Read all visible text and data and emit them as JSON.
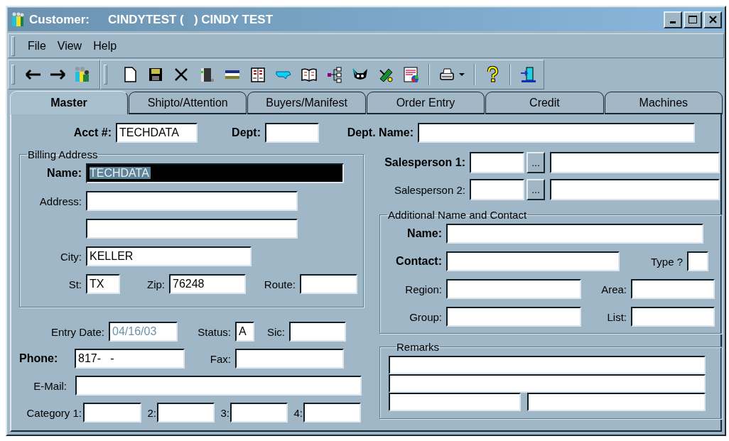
{
  "window": {
    "title": "Customer:",
    "record": "CINDYTEST (   ) CINDY TEST"
  },
  "menu": [
    {
      "label": "File"
    },
    {
      "label": "View"
    },
    {
      "label": "Help"
    }
  ],
  "tabs": [
    {
      "label": "Master",
      "selected": true
    },
    {
      "label": "Shipto/Attention",
      "selected": false
    },
    {
      "label": "Buyers/Manifest",
      "selected": false
    },
    {
      "label": "Order Entry",
      "selected": false
    },
    {
      "label": "Credit",
      "selected": false
    },
    {
      "label": "Machines",
      "selected": false
    }
  ],
  "header": [
    {
      "label": "Acct #:",
      "value": "TECHDATA",
      "bold": true,
      "selected": false
    },
    {
      "label": "Dept:",
      "bold": true,
      "selected": false
    },
    {
      "label": "Dept. Name:",
      "bold": true,
      "selected": false
    }
  ],
  "billing_address": {
    "title": "Billing Address",
    "rows": [
      {
        "fields": [
          {
            "label": "Name:",
            "value": "TECHDATA",
            "bold": true,
            "selected": true
          }
        ]
      },
      {
        "fields": [
          {
            "label": "Address:",
            "bold": false,
            "selected": false
          }
        ]
      },
      {
        "fields": [
          {
            "selected": false
          }
        ]
      },
      {
        "fields": [
          {
            "label": "City:",
            "value": "KELLER",
            "bold": false,
            "selected": false
          }
        ]
      },
      {
        "fields": [
          {
            "label": "St:",
            "value": "TX",
            "bold": false,
            "selected": false
          },
          {
            "label": "Zip:",
            "value": "76248",
            "bold": false,
            "selected": false
          },
          {
            "label": "Route:",
            "bold": false,
            "selected": false
          }
        ]
      }
    ]
  },
  "contact": {
    "rows": [
      {
        "fields": [
          {
            "label": "Entry Date:",
            "value": "04/16/03",
            "bold": false,
            "selected": false,
            "disabled": true
          },
          {
            "label": "Status:",
            "value": "A",
            "bold": false,
            "selected": false
          },
          {
            "label": "Sic:",
            "bold": false,
            "selected": false
          }
        ]
      },
      {
        "fields": [
          {
            "label": "Phone:",
            "value": "817-   -",
            "bold": true,
            "selected": false
          },
          {
            "label": "Fax:",
            "bold": false,
            "selected": false
          }
        ]
      },
      {
        "fields": [
          {
            "label": "E-Mail:",
            "bold": false,
            "selected": false
          }
        ]
      },
      {
        "fields": [
          {
            "label": "Category 1:",
            "bold": false,
            "selected": false
          },
          {
            "label": "2:",
            "bold": false,
            "selected": false
          },
          {
            "label": "3:",
            "bold": false,
            "selected": false
          },
          {
            "label": "4:",
            "bold": false,
            "selected": false
          }
        ]
      }
    ]
  },
  "salespersons": [
    {
      "label": "Salesperson 1:",
      "bold": true,
      "browse": "..."
    },
    {
      "label": "Salesperson 2:",
      "bold": false,
      "browse": "..."
    }
  ],
  "additional_contact": {
    "title": "Additional Name and Contact",
    "rows": [
      {
        "fields": [
          {
            "label": "Name:",
            "bold": true,
            "selected": false
          }
        ]
      },
      {
        "fields": [
          {
            "label": "Contact:",
            "bold": true,
            "selected": false
          },
          {
            "label": "Type ?",
            "bold": false,
            "selected": false
          }
        ]
      },
      {
        "fields": [
          {
            "label": "Region:",
            "bold": false,
            "selected": false
          },
          {
            "label": "Area:",
            "bold": false,
            "selected": false
          }
        ]
      },
      {
        "fields": [
          {
            "label": "Group:",
            "bold": false,
            "selected": false
          },
          {
            "label": "List:",
            "bold": false,
            "selected": false
          }
        ]
      }
    ]
  },
  "remarks": {
    "title": "Remarks",
    "rows": [
      {
        "fields": [
          {
            "selected": false
          }
        ]
      },
      {
        "fields": [
          {
            "selected": false
          }
        ]
      },
      {
        "fields": [
          {
            "selected": false
          },
          {
            "selected": false
          }
        ]
      }
    ]
  }
}
